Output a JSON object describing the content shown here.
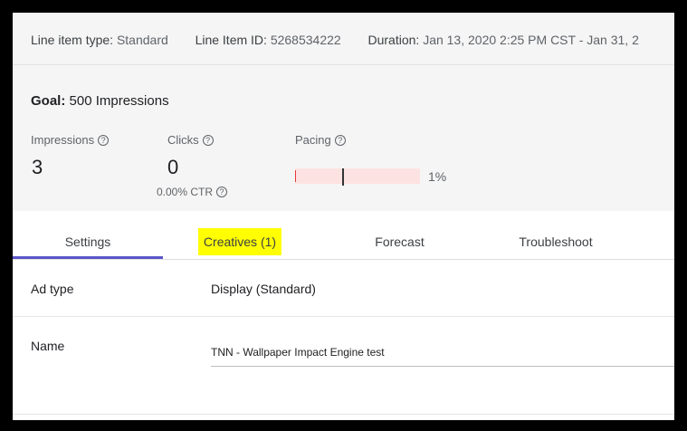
{
  "header": {
    "line_item_type_label": "Line item type:",
    "line_item_type_value": "Standard",
    "line_item_id_label": "Line Item ID:",
    "line_item_id_value": "5268534222",
    "duration_label": "Duration:",
    "duration_value": "Jan 13, 2020 2:25 PM CST - Jan 31, 2"
  },
  "summary": {
    "goal_label": "Goal:",
    "goal_value": "500 Impressions",
    "impressions_label": "Impressions",
    "impressions_value": "3",
    "clicks_label": "Clicks",
    "clicks_value": "0",
    "ctr_text": "0.00% CTR",
    "pacing_label": "Pacing",
    "pacing_percent": "1%",
    "pacing_fraction": 0.01,
    "help_glyph": "?"
  },
  "tabs": [
    {
      "label": "Settings",
      "active": true
    },
    {
      "label": "Creatives (1)",
      "highlighted": true
    },
    {
      "label": "Forecast"
    },
    {
      "label": "Troubleshoot"
    }
  ],
  "settings": {
    "ad_type_label": "Ad type",
    "ad_type_value": "Display (Standard)",
    "name_label": "Name",
    "name_value": "TNN - Wallpaper Impact Engine test"
  },
  "colors": {
    "tab_indicator": "#5a56c8",
    "highlight": "#ffff00",
    "pacing_bar_bg": "#fde2e2",
    "pacing_fill": "#e53935"
  },
  "icons": {
    "help": "help-circle-icon"
  }
}
